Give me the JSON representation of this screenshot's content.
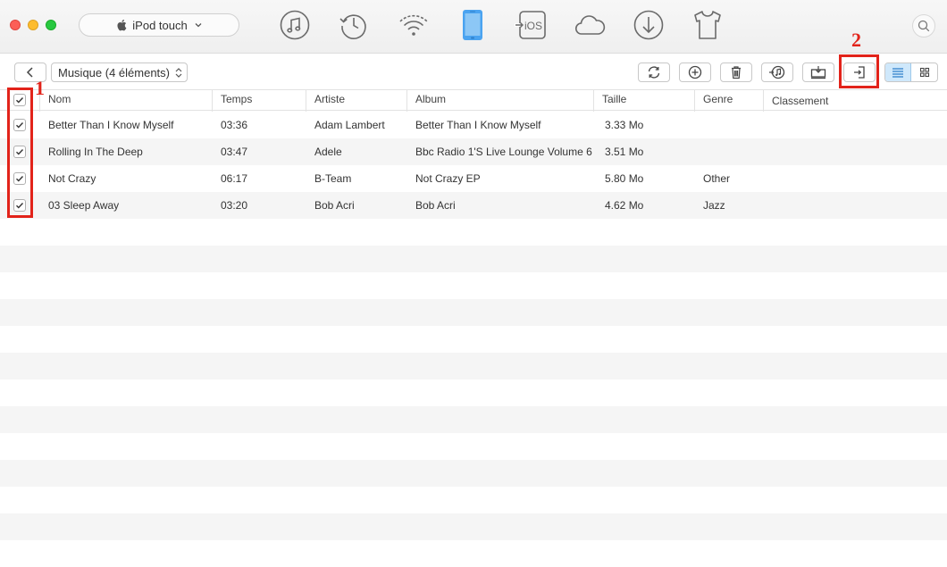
{
  "window": {
    "device_name": "iPod touch"
  },
  "top_toolbar": {
    "icons": [
      "music-icon",
      "history-icon",
      "wifi-icon",
      "device-icon",
      "to-ios-icon",
      "cloud-icon",
      "download-icon",
      "shirt-icon"
    ],
    "to_ios_label": "iOS",
    "active": "device-icon",
    "accent": "#4aa3f0"
  },
  "sub_toolbar": {
    "category": "Musique (4 éléments)",
    "actions": [
      "refresh-icon",
      "add-icon",
      "delete-icon",
      "add-to-itunes-icon",
      "export-to-computer-icon",
      "send-to-device-icon"
    ],
    "view": "list"
  },
  "table": {
    "columns": [
      "Nom",
      "Temps",
      "Artiste",
      "Album",
      "Taille",
      "Genre",
      "Classement"
    ],
    "rows": [
      {
        "checked": true,
        "name": "Better Than I Know Myself",
        "time": "03:36",
        "artist": "Adam Lambert",
        "album": "Better Than I Know Myself",
        "size": "3.33 Mo",
        "genre": "",
        "rating": ""
      },
      {
        "checked": true,
        "name": "Rolling In The Deep",
        "time": "03:47",
        "artist": "Adele",
        "album": "Bbc Radio 1'S Live Lounge Volume 6",
        "size": "3.51 Mo",
        "genre": "",
        "rating": ""
      },
      {
        "checked": true,
        "name": "Not Crazy",
        "time": "06:17",
        "artist": "B-Team",
        "album": "Not Crazy EP",
        "size": "5.80 Mo",
        "genre": "Other",
        "rating": ""
      },
      {
        "checked": true,
        "name": "03 Sleep Away",
        "time": "03:20",
        "artist": "Bob Acri",
        "album": "Bob Acri",
        "size": "4.62 Mo",
        "genre": "Jazz",
        "rating": ""
      }
    ],
    "header_checked": true
  },
  "callouts": [
    {
      "label": "1",
      "color": "#e2231a"
    },
    {
      "label": "2",
      "color": "#e2231a"
    }
  ]
}
